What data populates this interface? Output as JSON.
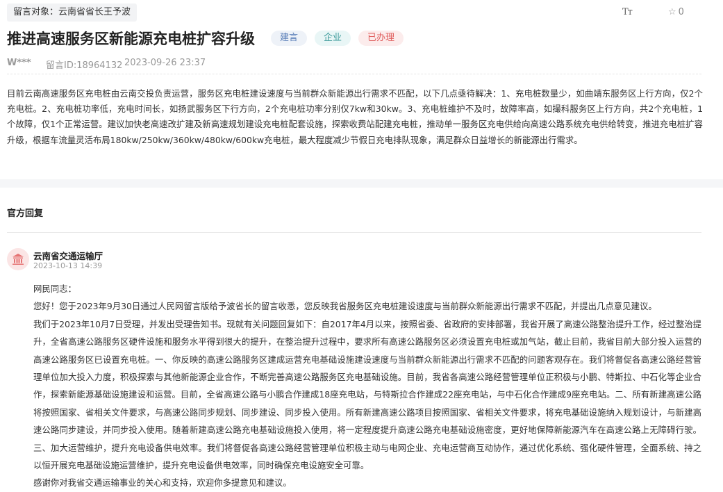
{
  "message": {
    "target": "留言对象：云南省省长王予波",
    "font_toggle": "Tт",
    "favorite_count": "0",
    "title": "推进高速服务区新能源充电桩扩容升级",
    "tags": [
      "建言",
      "企业",
      "已办理"
    ],
    "tag_colors": {
      "建言": "#5a7fb8",
      "企业": "#3c9a9a",
      "已办理": "#e0605f"
    },
    "user": "W***",
    "message_id": "留言ID:18964132",
    "time": "2023-09-26 23:37",
    "content": "目前云南高速服务区充电桩由云南交投负责运营，服务区充电桩建设速度与当前群众新能源出行需求不匹配，以下几点亟待解决：1、充电桩数量少，如曲靖东服务区上行方向，仅2个充电桩。2、充电桩功率低，充电时间长，如扬武服务区下行方向，2个充电桩功率分别仅7kw和30kw。3、充电桩维护不及时，故障率高，如撮科服务区上行方向，共2个充电桩，1个故障，仅1个正常运营。建议加快老高速改扩建及新高速规划建设充电桩配套设施，探索收费站配建充电桩，推动单一服务区充电供给向高速公路系统充电供给转变，推进充电桩扩容升级，根据车流量灵活布局180kw/250kw/360kw/480kw/600kw充电桩，最大程度减少节假日充电排队现象，满足群众日益增长的新能源出行需求。"
  },
  "reply": {
    "section_title": "官方回复",
    "department": "云南省交通运输厅",
    "time": "2023-10-13 14:39",
    "icons": {
      "avatar": "government-building-icon",
      "favorite": "star-icon",
      "font": "font-size-icon"
    },
    "paragraphs": [
      "网民同志：",
      "您好！您于2023年9月30日通过人民网留言版给予波省长的留言收悉，您反映我省服务区充电桩建设速度与当前群众新能源出行需求不匹配，并提出几点意见建议。",
      "我们于2023年10月7日受理，并发出受理告知书。现就有关问题回复如下：自2017年4月以来，按照省委、省政府的安排部署，我省开展了高速公路整治提升工作，经过整治提升，全省高速公路服务区硬件设施和服务水平得到很大的提升，在整治提升过程中，要求所有高速公路服务区必须设置充电桩或加气站，截止目前，我省目前大部分投入运营的高速公路服务区已设置充电桩。一、你反映的高速公路服务区建成运营充电基础设施建设速度与当前群众新能源出行需求不匹配的问题客观存在。我们将督促各高速公路经营管理单位加大投入力度，积极探索与其他新能源企业合作，不断完善高速公路服务区充电基础设施。目前，我省各高速公路经营管理单位正积极与小鹏、特斯拉、中石化等企业合作，探索新能源基础设施建设和运营。目前，全省高速公路与小鹏合作建成18座充电站，与特斯拉合作建成22座充电站，与中石化合作建成9座充电站。二、所有新建高速公路将按照国家、省相关文件要求，与高速公路同步规划、同步建设、同步投入使用。所有新建高速公路项目按照国家、省相关文件要求，将充电基础设施纳入规划设计，与新建高速公路同步建设，并同步投入使用。随着新建高速公路充电基础设施投入使用，将一定程度提升高速公路充电基础设施密度，更好地保障新能源汽车在高速公路上无障碍行驶。三、加大运营维护，提升充电设备供电效率。我们将督促各高速公路经营管理单位积极主动与电网企业、充电运营商互动协作，通过优化系统、强化硬件管理，全面系统、持之以恒开展充电基础设施运营维护，提升充电设备供电效率，同时确保充电设施安全可靠。",
      "感谢你对我省交通运输事业的关心和支持，欢迎你多提意见和建议。"
    ]
  }
}
